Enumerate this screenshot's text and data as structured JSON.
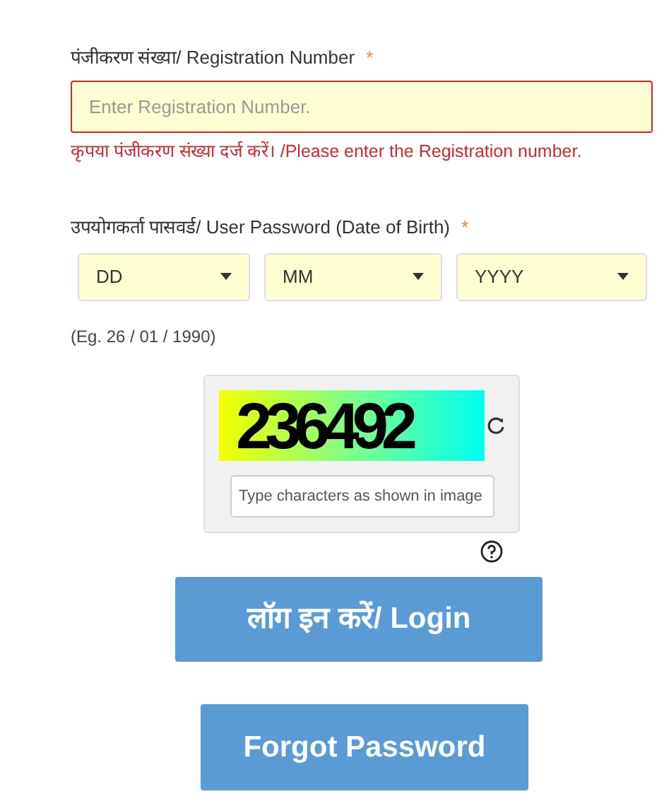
{
  "registration": {
    "label": "पंजीकरण संख्या/ Registration Number",
    "required_mark": "*",
    "placeholder": "Enter Registration Number.",
    "invalid": true,
    "error": "कृपया पंजीकरण संख्या दर्ज करें। /Please enter the Registration number."
  },
  "password": {
    "label": "उपयोगकर्ता पासवर्ड/ User Password (Date of Birth)",
    "required_mark": "*",
    "selects": [
      {
        "value": "DD"
      },
      {
        "value": "MM"
      },
      {
        "value": "YYYY"
      }
    ],
    "hint": "(Eg. 26 / 01 / 1990)"
  },
  "captcha": {
    "code": "236492",
    "placeholder": "Type characters as shown in image"
  },
  "buttons": [
    {
      "label": "लॉग इन करें/ Login"
    },
    {
      "label": "Forgot Password"
    }
  ]
}
